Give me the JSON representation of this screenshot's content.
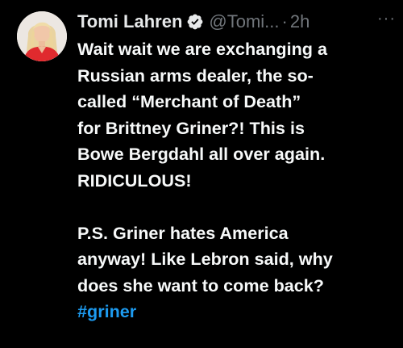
{
  "author": {
    "name": "Tomi Lahren",
    "handle": "@Tomi...",
    "separator": "·",
    "time": "2h",
    "more_icon": "more-dots-icon",
    "verified_icon": "verified-badge-icon"
  },
  "tweet": {
    "lines": [
      "Wait wait we are exchanging a",
      "Russian arms dealer, the so-",
      "called “Merchant of Death”",
      "for Brittney Griner?! This is",
      "Bowe Bergdahl all over again.",
      "RIDICULOUS!",
      "P.S. Griner hates America",
      "anyway! Like Lebron said, why",
      "does she want to come back?"
    ],
    "hashtag": "#griner"
  },
  "colors": {
    "background": "#000000",
    "text": "#e7e9ea",
    "secondary": "#71767b",
    "link": "#1d9bf0"
  }
}
